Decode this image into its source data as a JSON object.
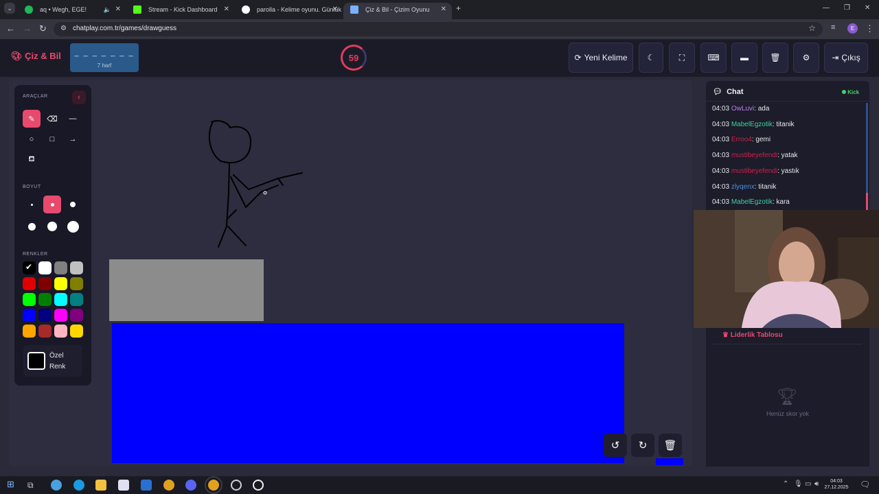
{
  "browser": {
    "tabs": [
      {
        "title": "aq • Wegh, EGE!",
        "fav_color": "#1db954"
      },
      {
        "title": "Stream - Kick Dashboard",
        "fav_color": "#53fc18"
      },
      {
        "title": "parolla - Kelime oyunu. Günlük",
        "fav_color": "#ffffff"
      },
      {
        "title": "Çiz & Bil - Çizim Oyunu",
        "fav_color": "#7ab0ff"
      }
    ],
    "url": "chatplay.com.tr/games/drawguess",
    "profile_initial": "E"
  },
  "header": {
    "logo": "Çiz & Bil",
    "word_mask": "_ _ _ _ _ _ _",
    "word_length": "7 harf",
    "timer": "59",
    "new_word": "Yeni Kelime",
    "exit": "Çıkış"
  },
  "tools": {
    "section_tools": "ARAÇLAR",
    "section_size": "BOYUT",
    "section_colors": "RENKLER",
    "custom_line1": "Özel",
    "custom_line2": "Renk",
    "colors": [
      "#000000",
      "#ffffff",
      "#808080",
      "#c0c0c0",
      "#e00000",
      "#800000",
      "#ffff00",
      "#808000",
      "#00ff00",
      "#008000",
      "#00ffff",
      "#008080",
      "#0000ff",
      "#000080",
      "#ff00ff",
      "#800080",
      "#ffa500",
      "#a52a2a",
      "#ffb6c1",
      "#ffd700"
    ]
  },
  "chat": {
    "title": "Chat",
    "platform": "Kick",
    "messages": [
      {
        "time": "04:03",
        "user": "OwLuvi",
        "text": ": ada",
        "color": "#c07cf0"
      },
      {
        "time": "04:03",
        "user": "MabelEgzotik",
        "text": ": titanik",
        "color": "#3fd0a0"
      },
      {
        "time": "04:03",
        "user": "Erroo4",
        "text": ": gemi",
        "color": "#d0204a"
      },
      {
        "time": "04:03",
        "user": "mustibeyefendi",
        "text": ": yatak",
        "color": "#d0204a"
      },
      {
        "time": "04:03",
        "user": "mustibeyefendi",
        "text": ": yastık",
        "color": "#d0204a"
      },
      {
        "time": "04:03",
        "user": "zlyqenx",
        "text": ": titanik",
        "color": "#4a90e2"
      },
      {
        "time": "04:03",
        "user": "MabelEgzotik",
        "text": ": kara",
        "color": "#3fd0a0"
      }
    ]
  },
  "leaderboard": {
    "title": "Liderlik Tablosu",
    "empty": "Henüz skor yok"
  },
  "taskbar": {
    "time": "04:03",
    "date": "27.12.2025"
  }
}
